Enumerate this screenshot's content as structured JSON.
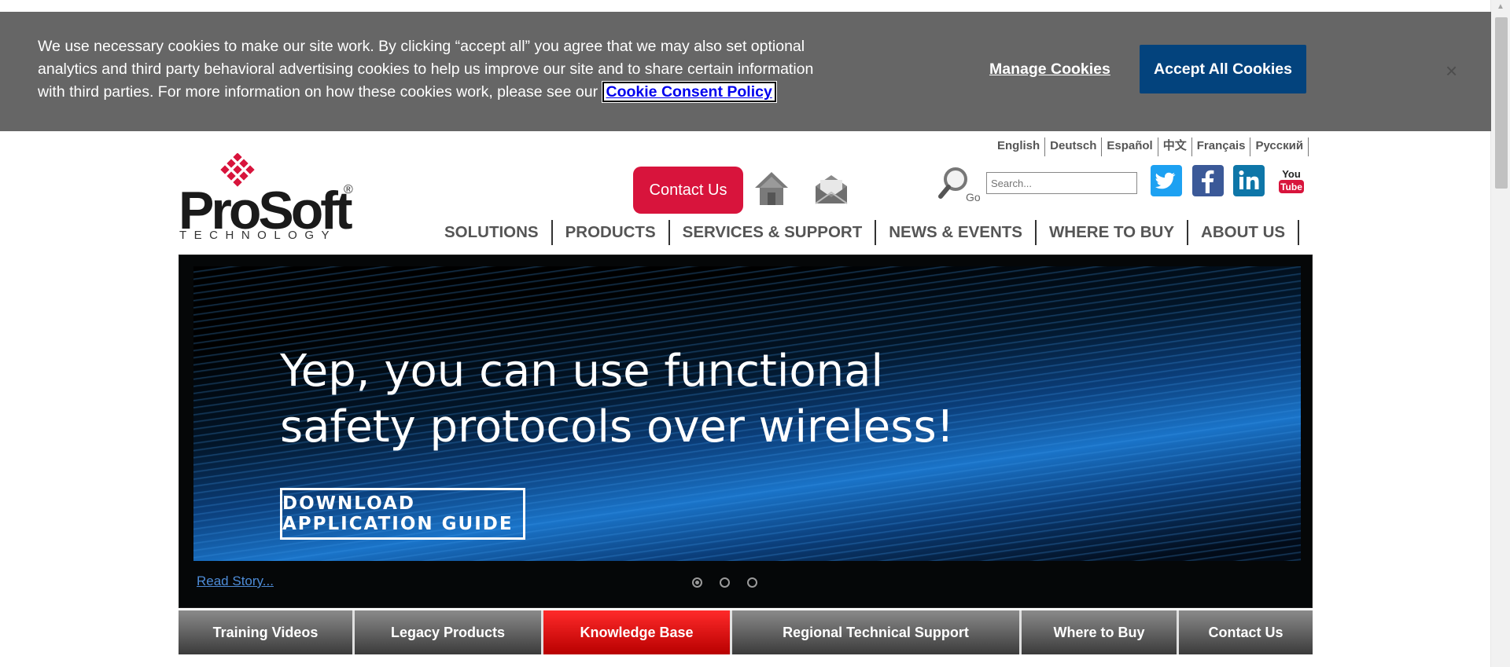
{
  "cookie": {
    "text": "We use necessary cookies to make our site work. By clicking “accept all” you agree that we may also set optional analytics and third party behavioral advertising cookies to help us improve our site and to share certain information with third parties. For more information on how these cookies work, please see our ",
    "policy_link": "Cookie Consent Policy",
    "manage": "Manage Cookies",
    "accept": "Accept All Cookies",
    "close": "×"
  },
  "languages": [
    "English",
    "Deutsch",
    "Español",
    "中文",
    "Français",
    "Русский"
  ],
  "logo": {
    "word": "ProSoft",
    "reg": "®",
    "sub": "TECHNOLOGY"
  },
  "header": {
    "contact": "Contact Us",
    "search_placeholder": "Search...",
    "search_go": "Go",
    "icons": [
      "home-icon",
      "mail-icon",
      "search-icon",
      "twitter-icon",
      "facebook-icon",
      "linkedin-icon",
      "youtube-icon"
    ]
  },
  "nav": [
    "SOLUTIONS",
    "PRODUCTS",
    "SERVICES & SUPPORT",
    "NEWS & EVENTS",
    "WHERE TO BUY",
    "ABOUT US"
  ],
  "hero": {
    "line1": "Yep, you can use functional",
    "line2": "safety protocols over wireless!",
    "cta": "DOWNLOAD APPLICATION GUIDE",
    "read_story": "Read Story...",
    "slides": 3,
    "active_slide": 1
  },
  "subnav": [
    "Training Videos",
    "Legacy Products",
    "Knowledge Base",
    "Regional Technical Support",
    "Where to Buy",
    "Contact Us"
  ],
  "colors": {
    "brand_red": "#d8143c",
    "accept_blue": "#03437d",
    "banner_gray": "#666666"
  }
}
